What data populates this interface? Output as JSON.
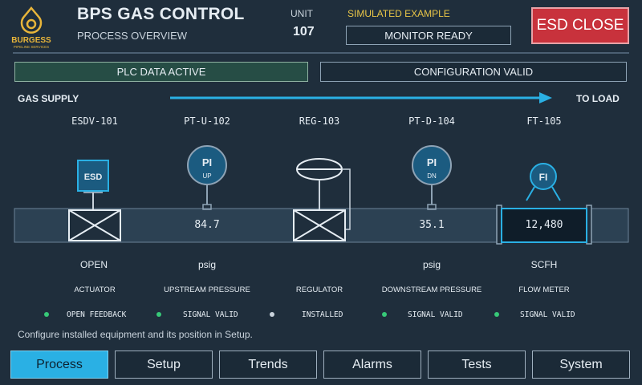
{
  "header": {
    "logo_text": "BURGESS",
    "logo_subtext": "PIPELINE SERVICES",
    "title": "BPS GAS CONTROL",
    "subtitle": "PROCESS OVERVIEW",
    "unit_label": "UNIT",
    "unit_value": "107",
    "mode_label": "SIMULATED EXAMPLE",
    "monitor_status": "MONITOR READY",
    "esd_button": "ESD CLOSE"
  },
  "status": {
    "plc": "PLC DATA ACTIVE",
    "config": "CONFIGURATION VALID"
  },
  "flow": {
    "from_label": "GAS SUPPLY",
    "to_label": "TO LOAD"
  },
  "equipment": [
    {
      "tag": "ESDV-101",
      "symbol": "ESD",
      "value": "",
      "unit": "OPEN",
      "description": "ACTUATOR",
      "state": "OPEN FEEDBACK",
      "state_color": "#37c978"
    },
    {
      "tag": "PT-U-102",
      "symbol": "PI",
      "symbol_sub": "UP",
      "value": "84.7",
      "unit": "psig",
      "description": "UPSTREAM PRESSURE",
      "state": "SIGNAL VALID",
      "state_color": "#37c978"
    },
    {
      "tag": "REG-103",
      "symbol": "",
      "value": "",
      "unit": "",
      "description": "REGULATOR",
      "state": "INSTALLED",
      "state_color": "#c9d3dc"
    },
    {
      "tag": "PT-D-104",
      "symbol": "PI",
      "symbol_sub": "DN",
      "value": "35.1",
      "unit": "psig",
      "description": "DOWNSTREAM PRESSURE",
      "state": "SIGNAL VALID",
      "state_color": "#37c978"
    },
    {
      "tag": "FT-105",
      "symbol": "FI",
      "value": "12,480",
      "unit": "SCFH",
      "description": "FLOW METER",
      "state": "SIGNAL VALID",
      "state_color": "#37c978"
    }
  ],
  "help_text": "Configure installed equipment and its position in Setup.",
  "nav": {
    "active": "Process",
    "items": [
      "Process",
      "Setup",
      "Trends",
      "Alarms",
      "Tests",
      "System"
    ]
  },
  "colors": {
    "accent": "#2ab0e4",
    "esd": "#c8323c",
    "ok": "#37c978",
    "warning": "#e8c547"
  }
}
